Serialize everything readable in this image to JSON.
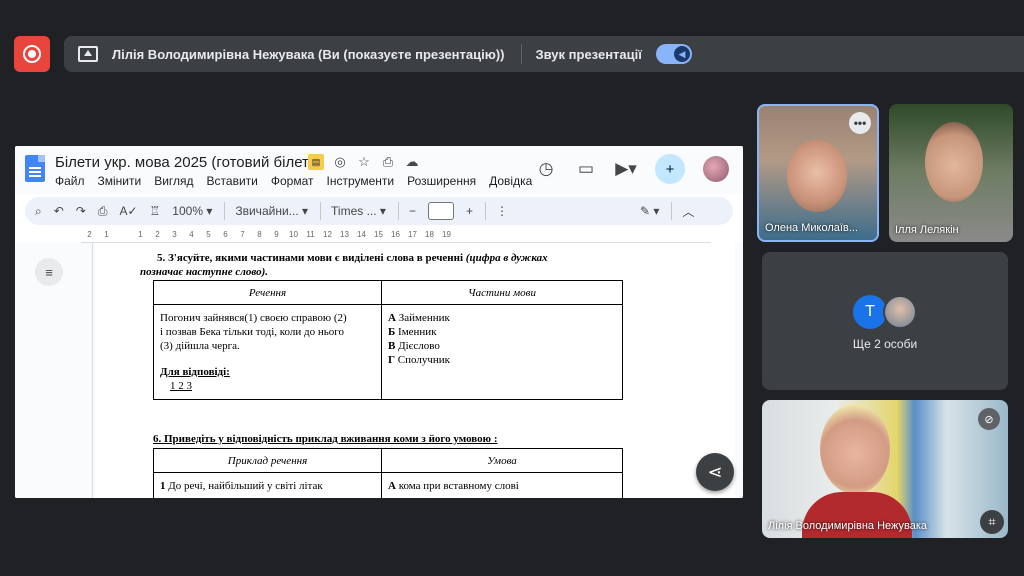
{
  "presenting_bar": {
    "text": "Лілія Володимирівна Нежувака (Ви (показуєте презентацію))",
    "sound_label": "Звук презентації",
    "sound_on": true
  },
  "docs": {
    "title": "Білети укр. мова 2025 (готовий білет)",
    "menu": [
      "Файл",
      "Змінити",
      "Вигляд",
      "Вставити",
      "Формат",
      "Інструменти",
      "Розширення",
      "Довідка"
    ],
    "toolbar": {
      "zoom": "100%",
      "style": "Звичайни...",
      "font": "Times ...",
      "font_size": ""
    },
    "ruler_numbers": [
      "2",
      "1",
      "",
      "1",
      "2",
      "3",
      "4",
      "5",
      "6",
      "7",
      "8",
      "9",
      "10",
      "11",
      "12",
      "13",
      "14",
      "15",
      "16",
      "17",
      "18",
      "19"
    ],
    "q5": {
      "heading": "5. З'ясуйте, якими частинами мови є виділені слова в реченні",
      "heading_italic": "(цифра в дужках",
      "heading_line2": "позначає наступне слово).",
      "col1": "Речення",
      "col2": "Частини мови",
      "sentence_lines": [
        "Погонич зайнявся(1) своєю справою (2)",
        "і  позвав Бека тільки тоді, коли до нього",
        "(3)  дійшла черга."
      ],
      "answer_label": "Для відповіді:",
      "answer_value": "1 2 3",
      "options": [
        {
          "letter": "А",
          "text": "Займенник"
        },
        {
          "letter": "Б",
          "text": "Іменник"
        },
        {
          "letter": "В",
          "text": "Дієслово"
        },
        {
          "letter": "Г",
          "text": "Сполучник"
        }
      ]
    },
    "q6": {
      "heading": "6. Приведіть у відповідність приклад вживання коми з його умовою :",
      "col1": "Приклад речення",
      "col2": "Умова",
      "row1_c1_num": "1",
      "row1_c1": "До речі, найбільший у світі літак",
      "row1_c2_letter": "А",
      "row1_c2": "кома при вставному слові"
    }
  },
  "participants": {
    "olena": "Олена Миколаїв...",
    "illia": "Ілля Лелякін",
    "more_initial": "Т",
    "more_label": "Ще 2 особи",
    "self": "Лілія Володимирівна Нежувака"
  },
  "colors": {
    "background": "#202124",
    "record": "#e8453c",
    "accent": "#8ab4f8"
  }
}
